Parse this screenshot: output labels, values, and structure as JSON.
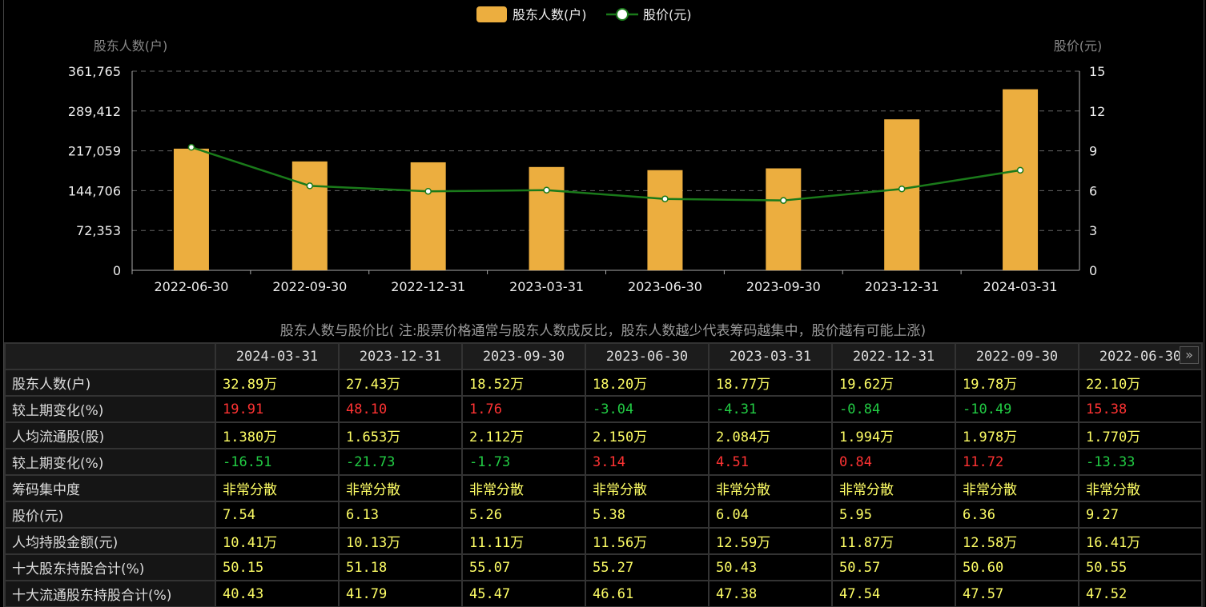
{
  "chart_data": {
    "type": "bar+line",
    "legend": [
      {
        "name": "股东人数(户)",
        "color": "#ecae3f"
      },
      {
        "name": "股价(元)",
        "color": "#1a7a1a"
      }
    ],
    "legend_position": "top-center",
    "categories": [
      "2022-06-30",
      "2022-09-30",
      "2022-12-31",
      "2023-03-31",
      "2023-06-30",
      "2023-09-30",
      "2023-12-31",
      "2024-03-31"
    ],
    "series": [
      {
        "name": "股东人数(户)",
        "type": "bar",
        "axis": "left",
        "values": [
          221000,
          197800,
          196200,
          187700,
          182000,
          185200,
          274300,
          328900
        ]
      },
      {
        "name": "股价(元)",
        "type": "line",
        "axis": "right",
        "values": [
          9.27,
          6.36,
          5.95,
          6.04,
          5.38,
          5.26,
          6.13,
          7.54
        ]
      }
    ],
    "ylabel": "股东人数(户)",
    "y2label": "股价(元)",
    "ylim": [
      0,
      361765
    ],
    "yticks": [
      "0",
      "72,353",
      "144,706",
      "217,059",
      "289,412",
      "361,765"
    ],
    "y2lim": [
      0,
      15
    ],
    "y2ticks": [
      "0",
      "3",
      "6",
      "9",
      "12",
      "15"
    ],
    "grid": true
  },
  "caption": "股东人数与股价比( 注:股票价格通常与股东人数成反比，股东人数越少代表筹码越集中，股价越有可能上涨)",
  "table": {
    "headers": [
      "2024-03-31",
      "2023-12-31",
      "2023-09-30",
      "2023-06-30",
      "2023-03-31",
      "2022-12-31",
      "2022-09-30",
      "2022-06-30"
    ],
    "more_icon": "double-chevron-right",
    "rows": [
      {
        "label": "股东人数(户)",
        "values": [
          "32.89万",
          "27.43万",
          "18.52万",
          "18.20万",
          "18.77万",
          "19.62万",
          "19.78万",
          "22.10万"
        ]
      },
      {
        "label": "较上期变化(%)",
        "values": [
          "19.91",
          "48.10",
          "1.76",
          "-3.04",
          "-4.31",
          "-0.84",
          "-10.49",
          "15.38"
        ]
      },
      {
        "label": "人均流通股(股)",
        "values": [
          "1.380万",
          "1.653万",
          "2.112万",
          "2.150万",
          "2.084万",
          "1.994万",
          "1.978万",
          "1.770万"
        ]
      },
      {
        "label": "较上期变化(%)",
        "values": [
          "-16.51",
          "-21.73",
          "-1.73",
          "3.14",
          "4.51",
          "0.84",
          "11.72",
          "-13.33"
        ]
      },
      {
        "label": "筹码集中度",
        "values": [
          "非常分散",
          "非常分散",
          "非常分散",
          "非常分散",
          "非常分散",
          "非常分散",
          "非常分散",
          "非常分散"
        ]
      },
      {
        "label": "股价(元)",
        "values": [
          "7.54",
          "6.13",
          "5.26",
          "5.38",
          "6.04",
          "5.95",
          "6.36",
          "9.27"
        ]
      },
      {
        "label": "人均持股金额(元)",
        "values": [
          "10.41万",
          "10.13万",
          "11.11万",
          "11.56万",
          "12.59万",
          "11.87万",
          "12.58万",
          "16.41万"
        ]
      },
      {
        "label": "十大股东持股合计(%)",
        "values": [
          "50.15",
          "51.18",
          "55.07",
          "55.27",
          "50.43",
          "50.57",
          "50.60",
          "50.55"
        ]
      },
      {
        "label": "十大流通股东持股合计(%)",
        "values": [
          "40.43",
          "41.79",
          "45.47",
          "46.61",
          "47.38",
          "47.54",
          "47.57",
          "47.52"
        ]
      }
    ]
  }
}
